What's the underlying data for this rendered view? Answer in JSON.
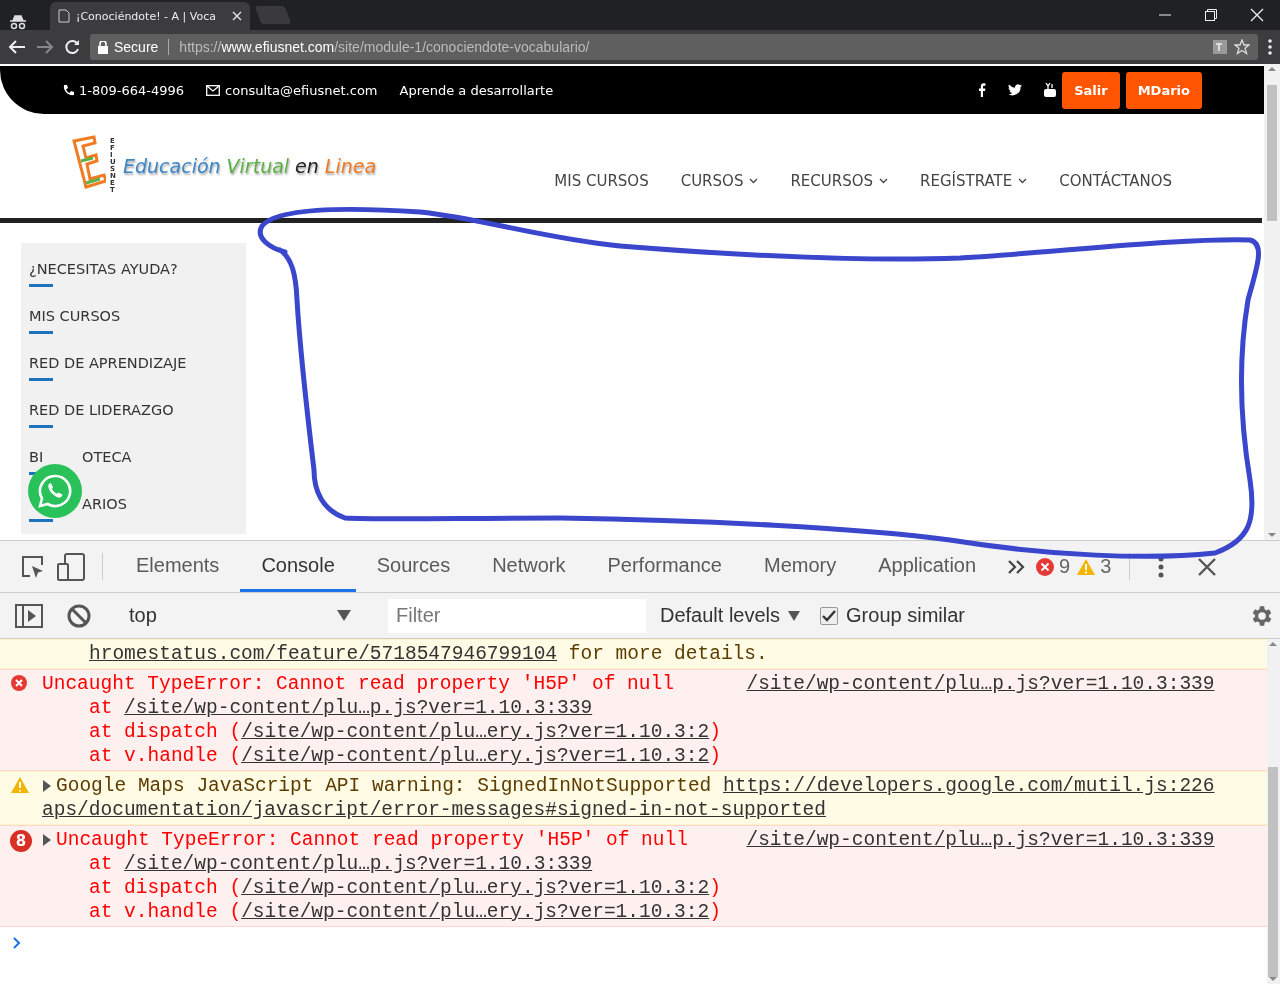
{
  "browser": {
    "tab_title": "¡Conociéndote! - A | Voca",
    "secure_label": "Secure",
    "url": {
      "scheme": "https://",
      "host": "www.efiusnet.com",
      "path": "/site/module-1/conociendote-vocabulario/"
    }
  },
  "topbar": {
    "phone": "1-809-664-4996",
    "email": "consulta@efiusnet.com",
    "tagline": "Aprende a desarrollarte",
    "buttons": [
      "Salir",
      "MDario"
    ]
  },
  "logo": {
    "side_text": "EFIUSNET",
    "words": [
      {
        "text": "Educación",
        "color": "#3a86c8"
      },
      {
        "text": "Virtual",
        "color": "#5cb146"
      },
      {
        "text": "en",
        "color": "#222222"
      },
      {
        "text": "Linea",
        "color": "#f07b22"
      }
    ]
  },
  "nav": [
    {
      "label": "MIS CURSOS",
      "has_menu": false
    },
    {
      "label": "CURSOS",
      "has_menu": true
    },
    {
      "label": "RECURSOS",
      "has_menu": true
    },
    {
      "label": "REGÍSTRATE",
      "has_menu": true
    },
    {
      "label": "CONTÁCTANOS",
      "has_menu": false
    }
  ],
  "sidebar": {
    "items": [
      {
        "text": "¿NECESITAS AYUDA?",
        "covered": false
      },
      {
        "text": "MIS CURSOS",
        "covered": false
      },
      {
        "text": "RED DE APRENDIZAJE",
        "covered": false
      },
      {
        "text": "RED DE LIDERAZGO",
        "covered": false
      },
      {
        "lead": "BI",
        "text": "OTECA",
        "covered": true
      },
      {
        "text": "ARIOS",
        "covered": true
      }
    ]
  },
  "devtools": {
    "tabs": [
      {
        "label": "Elements",
        "selected": false
      },
      {
        "label": "Console",
        "selected": true
      },
      {
        "label": "Sources",
        "selected": false
      },
      {
        "label": "Network",
        "selected": false
      },
      {
        "label": "Performance",
        "selected": false
      },
      {
        "label": "Memory",
        "selected": false
      },
      {
        "label": "Application",
        "selected": false
      }
    ],
    "error_count": "9",
    "warning_count": "3",
    "toolbar": {
      "context": "top",
      "filter_placeholder": "Filter",
      "levels": "Default levels",
      "group_similar": {
        "label": "Group similar",
        "checked": true
      }
    },
    "messages": [
      {
        "kind": "warning",
        "show_icon": false,
        "expandable": false,
        "lines": [
          {
            "indent": true,
            "segments": [
              {
                "text": "hromestatus.com/feature/5718547946799104",
                "link": true
              },
              {
                "text": " for more details.",
                "link": false
              }
            ]
          }
        ]
      },
      {
        "kind": "error",
        "show_icon": true,
        "expandable": false,
        "source": "/site/wp-content/plu…p.js?ver=1.10.3:339",
        "lines": [
          {
            "indent": false,
            "segments": [
              {
                "text": "Uncaught TypeError: Cannot read property 'H5P' of null",
                "link": false
              }
            ]
          },
          {
            "indent": true,
            "segments": [
              {
                "text": "at ",
                "link": false
              },
              {
                "text": "/site/wp-content/plu…p.js?ver=1.10.3:339",
                "link": true
              }
            ]
          },
          {
            "indent": true,
            "segments": [
              {
                "text": "at dispatch (",
                "link": false
              },
              {
                "text": "/site/wp-content/plu…ery.js?ver=1.10.3:2",
                "link": true
              },
              {
                "text": ")",
                "link": false
              }
            ]
          },
          {
            "indent": true,
            "segments": [
              {
                "text": "at v.handle (",
                "link": false
              },
              {
                "text": "/site/wp-content/plu…ery.js?ver=1.10.3:2",
                "link": true
              },
              {
                "text": ")",
                "link": false
              }
            ]
          }
        ]
      },
      {
        "kind": "warning",
        "show_icon": true,
        "expandable": true,
        "source": "util.js:226",
        "lines": [
          {
            "indent": false,
            "segments": [
              {
                "text": "Google Maps JavaScript API warning: SignedInNotSupported ",
                "link": false
              },
              {
                "text": "https://developers.google.com/m",
                "link": true
              }
            ]
          },
          {
            "indent": false,
            "segments": [
              {
                "text": "aps/documentation/javascript/error-messages#signed-in-not-supported",
                "link": true
              }
            ]
          }
        ]
      },
      {
        "kind": "error",
        "show_icon": true,
        "count": "8",
        "expandable": true,
        "source": "/site/wp-content/plu…p.js?ver=1.10.3:339",
        "lines": [
          {
            "indent": false,
            "segments": [
              {
                "text": "Uncaught TypeError: Cannot read property 'H5P' of null",
                "link": false
              }
            ]
          },
          {
            "indent": true,
            "segments": [
              {
                "text": "at ",
                "link": false
              },
              {
                "text": "/site/wp-content/plu…p.js?ver=1.10.3:339",
                "link": true
              }
            ]
          },
          {
            "indent": true,
            "segments": [
              {
                "text": "at dispatch (",
                "link": false
              },
              {
                "text": "/site/wp-content/plu…ery.js?ver=1.10.3:2",
                "link": true
              },
              {
                "text": ")",
                "link": false
              }
            ]
          },
          {
            "indent": true,
            "segments": [
              {
                "text": "at v.handle (",
                "link": false
              },
              {
                "text": "/site/wp-content/plu…ery.js?ver=1.10.3:2",
                "link": true
              },
              {
                "text": ")",
                "link": false
              }
            ]
          }
        ]
      }
    ]
  }
}
